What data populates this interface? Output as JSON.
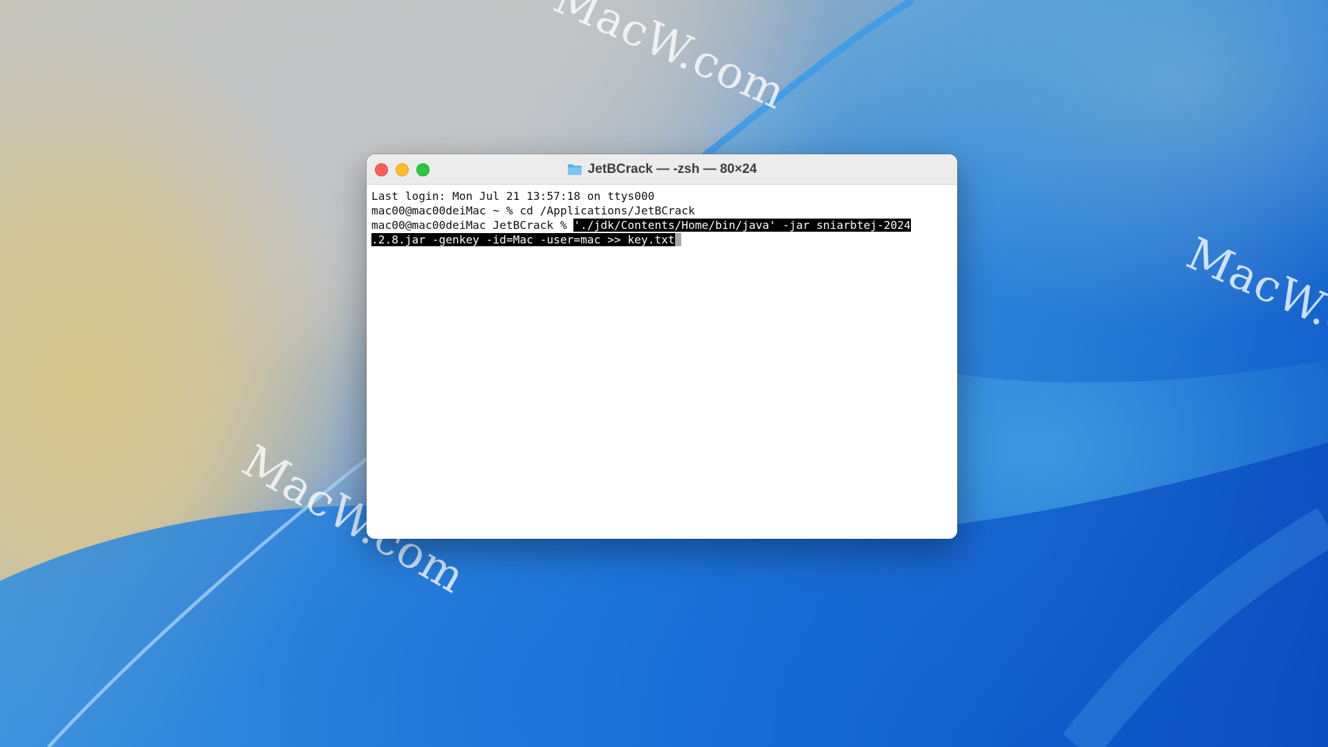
{
  "desktop": {
    "watermark_text": "MacW.com",
    "colors": {
      "wallpaper_blue": "#1262d1",
      "wallpaper_sand": "#d9c68e",
      "wave_highlight": "#7fc7f0"
    }
  },
  "window": {
    "title": "JetBCrack — -zsh — 80×24",
    "title_icon": "folder-icon",
    "buttons": {
      "close_color": "#fe5f57",
      "minimize_color": "#febc2e",
      "zoom_color": "#28c840"
    }
  },
  "terminal": {
    "lines": {
      "last_login": "Last login: Mon Jul 21 13:57:18 on ttys000",
      "cd_prompt": "mac00@mac00deiMac ~ % ",
      "cd_command": "cd /Applications/JetBCrack",
      "run_prompt": "mac00@mac00deiMac JetBCrack % ",
      "run_command_part1": "'./jdk/Contents/Home/bin/java' -jar sniarbtej-2024",
      "run_command_part2": ".2.8.jar -genkey -id=Mac -user=mac >> key.txt"
    },
    "selection_color": "#000000",
    "cursor_color": "#a9a9a9"
  }
}
